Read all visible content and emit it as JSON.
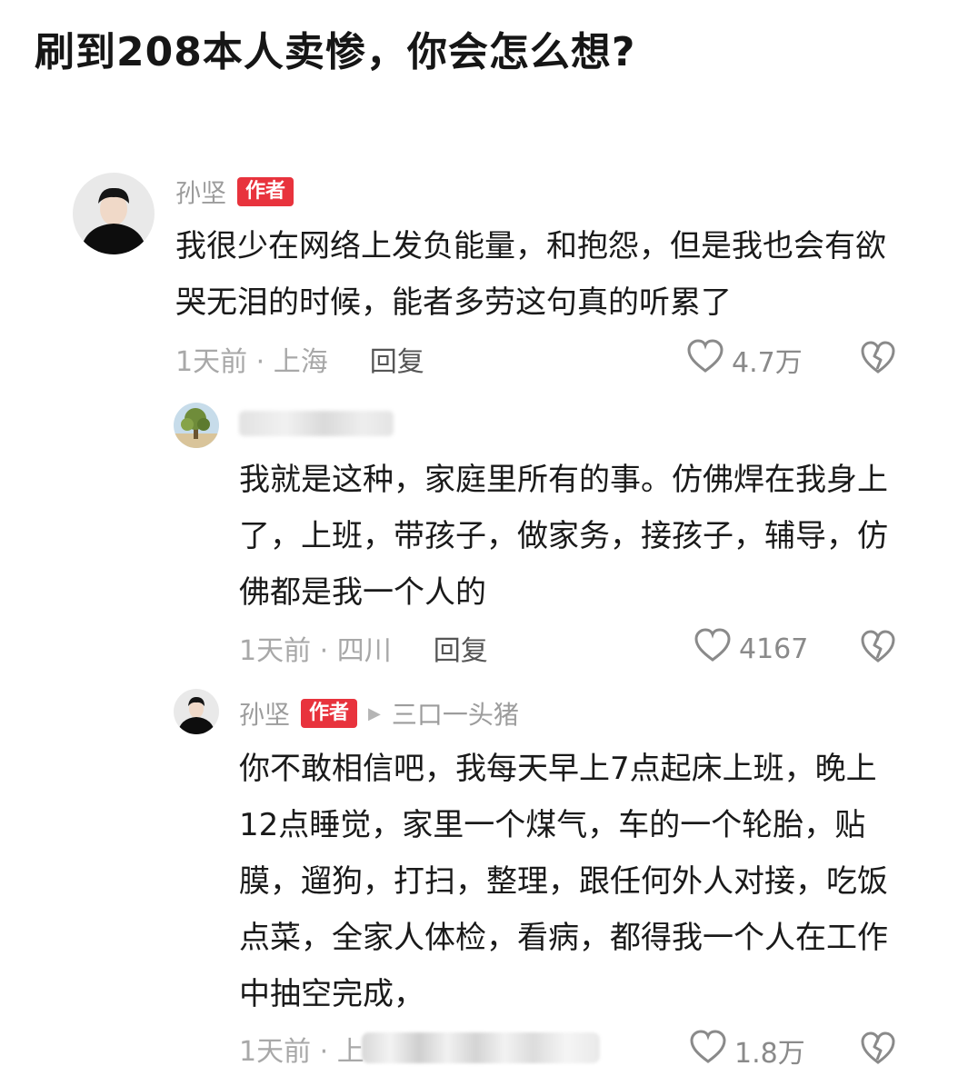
{
  "post": {
    "title": "刷到208本人卖惨，你会怎么想?"
  },
  "badge_label": "作者",
  "comments": [
    {
      "author": "孙坚",
      "text": "我很少在网络上发负能量，和抱怨，但是我也会有欲哭无泪的时候，能者多劳这句真的听累了",
      "time_location": "1天前 · 上海",
      "reply_label": "回复",
      "likes": "4.7万"
    },
    {
      "text": "我就是这种，家庭里所有的事。仿佛焊在我身上了，上班，带孩子，做家务，接孩子，辅导，仿佛都是我一个人的",
      "time_location": "1天前 · 四川",
      "reply_label": "回复",
      "likes": "4167"
    },
    {
      "author": "孙坚",
      "reply_to": "三口一头猪",
      "text": "你不敢相信吧，我每天早上7点起床上班，晚上12点睡觉，家里一个煤气，车的一个轮胎，贴膜，遛狗，打扫，整理，跟任何外人对接，吃饭点菜，全家人体检，看病，都得我一个人在工作中抽空完成，",
      "time_location": "1天前 · 上",
      "likes": "1.8万"
    }
  ],
  "icons": {
    "like": "heart-outline-icon",
    "dislike": "broken-heart-icon",
    "reply_arrow": "triangle-right-icon"
  },
  "colors": {
    "badge": "#e8333d",
    "muted_text": "#9c9c9c",
    "body_text": "#1a1a1a"
  }
}
